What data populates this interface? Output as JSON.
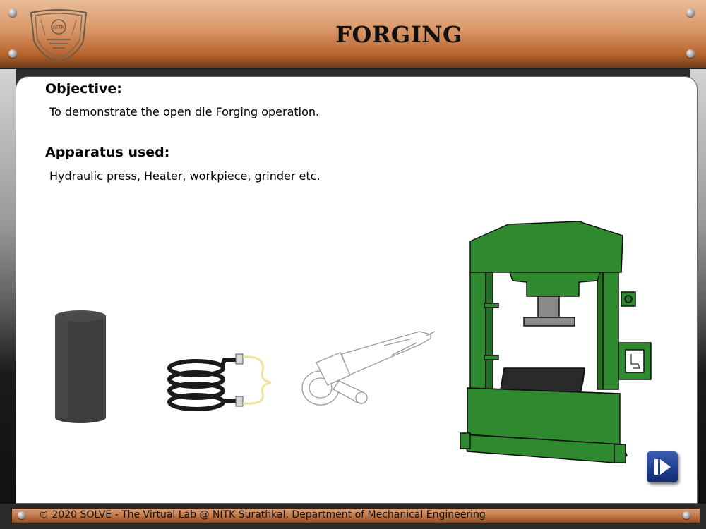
{
  "header": {
    "title": "FORGING",
    "logo_icon": "nitk-emblem-icon",
    "colors": {
      "copper_light": "#e9bd97",
      "copper_dark": "#b8652e"
    }
  },
  "objective": {
    "heading": "Objective:",
    "text": "To demonstrate the open die Forging operation."
  },
  "apparatus": {
    "heading": "Apparatus used:",
    "text": "Hydraulic press, Heater, workpiece, grinder etc.",
    "items": [
      "workpiece-icon",
      "heater-coil-icon",
      "angle-grinder-icon",
      "hydraulic-press-icon"
    ]
  },
  "navigation": {
    "next_icon": "next-arrow-icon",
    "accent": "#1f3d8f"
  },
  "footer": {
    "text": "© 2020 SOLVE - The Virtual Lab @ NITK Surathkal, Department of Mechanical Engineering"
  },
  "press_color": "#2f8a2f"
}
